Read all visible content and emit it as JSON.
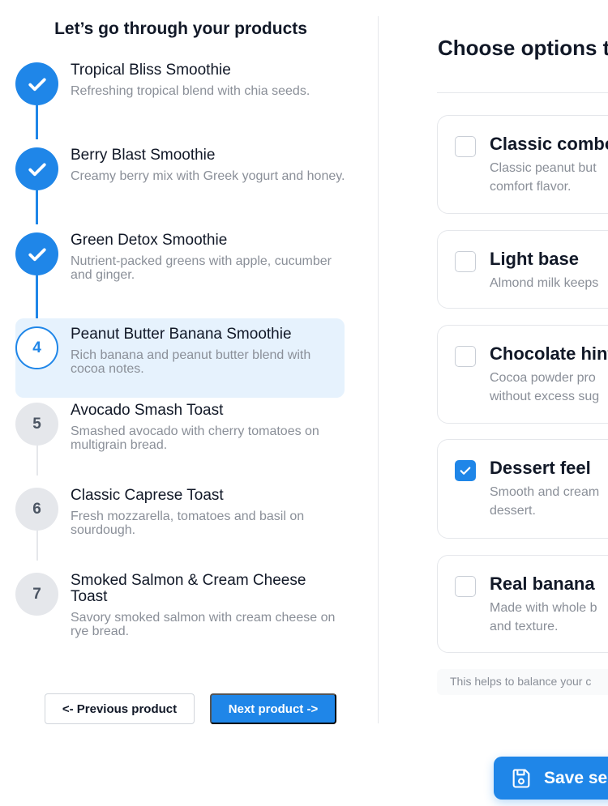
{
  "left": {
    "title": "Let’s go through your products",
    "steps": [
      {
        "marker": "",
        "state": "done",
        "title": "Tropical Bliss Smoothie",
        "description": "Refreshing tropical blend with chia seeds."
      },
      {
        "marker": "",
        "state": "done",
        "title": "Berry Blast Smoothie",
        "description": "Creamy berry mix with Greek yogurt and honey."
      },
      {
        "marker": "",
        "state": "done",
        "title": "Green Detox Smoothie",
        "description": "Nutrient-packed greens with apple, cucumber and ginger."
      },
      {
        "marker": "4",
        "state": "current",
        "title": "Peanut Butter Banana Smoothie",
        "description": "Rich banana and peanut butter blend with cocoa notes."
      },
      {
        "marker": "5",
        "state": "todo",
        "title": "Avocado Smash Toast",
        "description": "Smashed avocado with cherry tomatoes on multigrain bread."
      },
      {
        "marker": "6",
        "state": "todo",
        "title": "Classic Caprese Toast",
        "description": "Fresh mozzarella, tomatoes and basil on sourdough."
      },
      {
        "marker": "7",
        "state": "todo",
        "title": "Smoked Salmon & Cream Cheese Toast",
        "description": "Savory smoked salmon with cream cheese on rye bread."
      }
    ],
    "prev_label": "<- Previous product",
    "next_label": "Next product ->"
  },
  "right": {
    "title": "Choose options t",
    "options": [
      {
        "title": "Classic combo",
        "description": "Classic peanut but\ncomfort flavor.",
        "checked": false
      },
      {
        "title": "Light base",
        "description": "Almond milk keeps",
        "checked": false
      },
      {
        "title": "Chocolate hint",
        "description": "Cocoa powder pro\nwithout excess sug",
        "checked": false
      },
      {
        "title": "Dessert feel",
        "description": "Smooth and cream\ndessert.",
        "checked": true
      },
      {
        "title": "Real banana",
        "description": "Made with whole b\nand texture.",
        "checked": false
      }
    ],
    "hint": "This helps to balance your c",
    "save_label": "Save sel"
  },
  "colors": {
    "accent": "#1f86e8",
    "active_bg": "#e6f2fd",
    "muted_text": "#8a8f98"
  }
}
